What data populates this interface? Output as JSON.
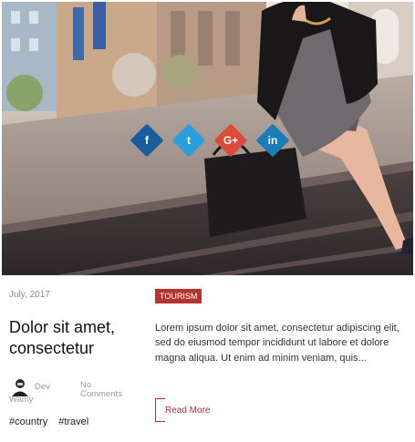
{
  "share": {
    "buttons": [
      {
        "network": "facebook",
        "glyph": "f",
        "color": "#1a5d9c",
        "icon": "facebook-icon"
      },
      {
        "network": "twitter",
        "glyph": "t",
        "color": "#2b9fdc",
        "icon": "twitter-icon"
      },
      {
        "network": "google-plus",
        "glyph": "G+",
        "color": "#dd4a3a",
        "icon": "google-plus-icon"
      },
      {
        "network": "linkedin",
        "glyph": "in",
        "color": "#1b7cb8",
        "icon": "linkedin-icon"
      }
    ]
  },
  "post": {
    "date": "July, 2017",
    "title": "Dolor sit amet, consectetur",
    "author": "Dev Wamy",
    "comments": "No Comments",
    "tags": [
      "#country",
      "#travel"
    ],
    "category": "TOURISM",
    "excerpt": "Lorem ipsum dolor sit amet, consectetur adipiscing elit, sed do eiusmod tempor incididunt ut labore et dolore magna aliqua. Ut enim ad minim veniam, quis...",
    "read_more": "Read More"
  },
  "colors": {
    "accent": "#b5322d",
    "muted_text": "#9a9a9a"
  }
}
